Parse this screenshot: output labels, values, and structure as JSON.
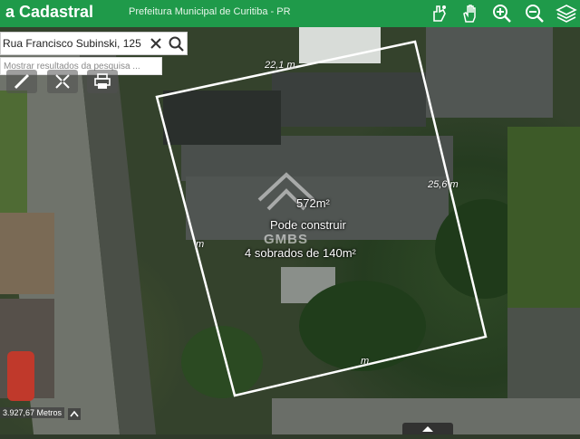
{
  "header": {
    "app_title": "a Cadastral",
    "org_name": "Prefeitura Municipal de Curitiba - PR",
    "icons": [
      "identify-hand-icon",
      "pan-hand-icon",
      "zoom-in-icon",
      "zoom-out-icon",
      "layers-icon"
    ]
  },
  "search": {
    "value": "Rua Francisco Subinski, 125",
    "hint": "Mostrar resultados da pesquisa ..."
  },
  "tools": [
    "measure-icon",
    "move-icon",
    "print-icon"
  ],
  "parcel": {
    "dim_top": "22,1 m",
    "dim_right": "25,6 m",
    "dim_left": "m",
    "dim_bottom": "m",
    "area": "572m²",
    "line1": "Pode construir",
    "line2": "4 sobrados de 140m²",
    "watermark": "GMBS"
  },
  "scale": {
    "text": "3.927,67 Metros"
  },
  "colors": {
    "header_green": "#1f9a4a",
    "parcel_outline": "#ffffff"
  }
}
